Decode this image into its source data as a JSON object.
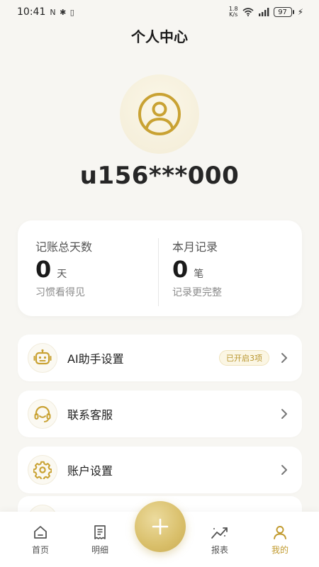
{
  "status_bar": {
    "time": "10:41",
    "left_icons": "N ✱ ▯",
    "net_speed_top": "1.8",
    "net_speed_bottom": "K/s",
    "battery": "97"
  },
  "header": {
    "title": "个人中心"
  },
  "profile": {
    "username": "u156***000"
  },
  "stats": {
    "total_days": {
      "label": "记账总天数",
      "value": "0",
      "unit": "天",
      "hint": "习惯看得见"
    },
    "month_records": {
      "label": "本月记录",
      "value": "0",
      "unit": "笔",
      "hint": "记录更完整"
    }
  },
  "menu": [
    {
      "label": "AI助手设置",
      "badge": "已开启3项",
      "icon": "robot-icon"
    },
    {
      "label": "联系客服",
      "icon": "headset-icon"
    },
    {
      "label": "账户设置",
      "icon": "gear-icon"
    }
  ],
  "nav": {
    "home": "首页",
    "details": "明细",
    "reports": "报表",
    "mine": "我的"
  },
  "colors": {
    "accent": "#c19a2e",
    "background": "#f7f6f2",
    "card": "#ffffff"
  }
}
